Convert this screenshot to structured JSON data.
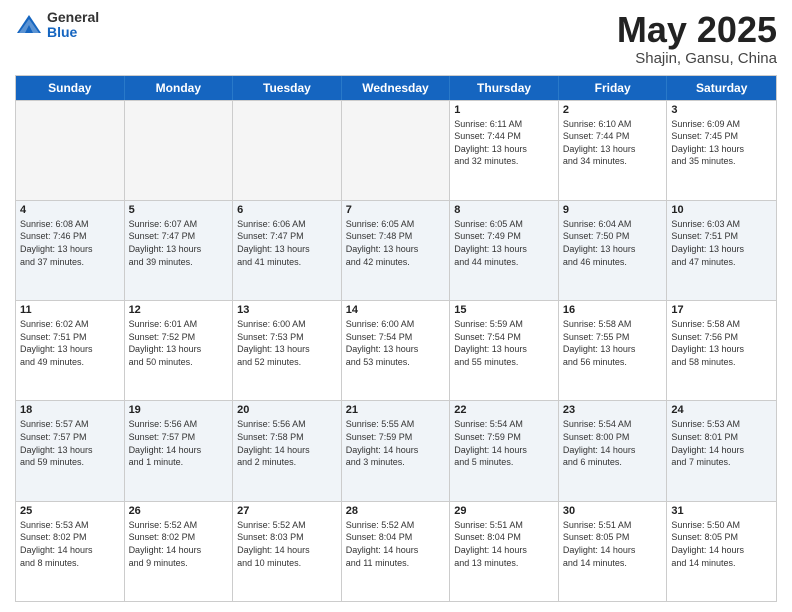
{
  "header": {
    "logo_general": "General",
    "logo_blue": "Blue",
    "title": "May 2025",
    "location": "Shajin, Gansu, China"
  },
  "days_of_week": [
    "Sunday",
    "Monday",
    "Tuesday",
    "Wednesday",
    "Thursday",
    "Friday",
    "Saturday"
  ],
  "weeks": [
    [
      {
        "day": "",
        "info": ""
      },
      {
        "day": "",
        "info": ""
      },
      {
        "day": "",
        "info": ""
      },
      {
        "day": "",
        "info": ""
      },
      {
        "day": "1",
        "info": "Sunrise: 6:11 AM\nSunset: 7:44 PM\nDaylight: 13 hours\nand 32 minutes."
      },
      {
        "day": "2",
        "info": "Sunrise: 6:10 AM\nSunset: 7:44 PM\nDaylight: 13 hours\nand 34 minutes."
      },
      {
        "day": "3",
        "info": "Sunrise: 6:09 AM\nSunset: 7:45 PM\nDaylight: 13 hours\nand 35 minutes."
      }
    ],
    [
      {
        "day": "4",
        "info": "Sunrise: 6:08 AM\nSunset: 7:46 PM\nDaylight: 13 hours\nand 37 minutes."
      },
      {
        "day": "5",
        "info": "Sunrise: 6:07 AM\nSunset: 7:47 PM\nDaylight: 13 hours\nand 39 minutes."
      },
      {
        "day": "6",
        "info": "Sunrise: 6:06 AM\nSunset: 7:47 PM\nDaylight: 13 hours\nand 41 minutes."
      },
      {
        "day": "7",
        "info": "Sunrise: 6:05 AM\nSunset: 7:48 PM\nDaylight: 13 hours\nand 42 minutes."
      },
      {
        "day": "8",
        "info": "Sunrise: 6:05 AM\nSunset: 7:49 PM\nDaylight: 13 hours\nand 44 minutes."
      },
      {
        "day": "9",
        "info": "Sunrise: 6:04 AM\nSunset: 7:50 PM\nDaylight: 13 hours\nand 46 minutes."
      },
      {
        "day": "10",
        "info": "Sunrise: 6:03 AM\nSunset: 7:51 PM\nDaylight: 13 hours\nand 47 minutes."
      }
    ],
    [
      {
        "day": "11",
        "info": "Sunrise: 6:02 AM\nSunset: 7:51 PM\nDaylight: 13 hours\nand 49 minutes."
      },
      {
        "day": "12",
        "info": "Sunrise: 6:01 AM\nSunset: 7:52 PM\nDaylight: 13 hours\nand 50 minutes."
      },
      {
        "day": "13",
        "info": "Sunrise: 6:00 AM\nSunset: 7:53 PM\nDaylight: 13 hours\nand 52 minutes."
      },
      {
        "day": "14",
        "info": "Sunrise: 6:00 AM\nSunset: 7:54 PM\nDaylight: 13 hours\nand 53 minutes."
      },
      {
        "day": "15",
        "info": "Sunrise: 5:59 AM\nSunset: 7:54 PM\nDaylight: 13 hours\nand 55 minutes."
      },
      {
        "day": "16",
        "info": "Sunrise: 5:58 AM\nSunset: 7:55 PM\nDaylight: 13 hours\nand 56 minutes."
      },
      {
        "day": "17",
        "info": "Sunrise: 5:58 AM\nSunset: 7:56 PM\nDaylight: 13 hours\nand 58 minutes."
      }
    ],
    [
      {
        "day": "18",
        "info": "Sunrise: 5:57 AM\nSunset: 7:57 PM\nDaylight: 13 hours\nand 59 minutes."
      },
      {
        "day": "19",
        "info": "Sunrise: 5:56 AM\nSunset: 7:57 PM\nDaylight: 14 hours\nand 1 minute."
      },
      {
        "day": "20",
        "info": "Sunrise: 5:56 AM\nSunset: 7:58 PM\nDaylight: 14 hours\nand 2 minutes."
      },
      {
        "day": "21",
        "info": "Sunrise: 5:55 AM\nSunset: 7:59 PM\nDaylight: 14 hours\nand 3 minutes."
      },
      {
        "day": "22",
        "info": "Sunrise: 5:54 AM\nSunset: 7:59 PM\nDaylight: 14 hours\nand 5 minutes."
      },
      {
        "day": "23",
        "info": "Sunrise: 5:54 AM\nSunset: 8:00 PM\nDaylight: 14 hours\nand 6 minutes."
      },
      {
        "day": "24",
        "info": "Sunrise: 5:53 AM\nSunset: 8:01 PM\nDaylight: 14 hours\nand 7 minutes."
      }
    ],
    [
      {
        "day": "25",
        "info": "Sunrise: 5:53 AM\nSunset: 8:02 PM\nDaylight: 14 hours\nand 8 minutes."
      },
      {
        "day": "26",
        "info": "Sunrise: 5:52 AM\nSunset: 8:02 PM\nDaylight: 14 hours\nand 9 minutes."
      },
      {
        "day": "27",
        "info": "Sunrise: 5:52 AM\nSunset: 8:03 PM\nDaylight: 14 hours\nand 10 minutes."
      },
      {
        "day": "28",
        "info": "Sunrise: 5:52 AM\nSunset: 8:04 PM\nDaylight: 14 hours\nand 11 minutes."
      },
      {
        "day": "29",
        "info": "Sunrise: 5:51 AM\nSunset: 8:04 PM\nDaylight: 14 hours\nand 13 minutes."
      },
      {
        "day": "30",
        "info": "Sunrise: 5:51 AM\nSunset: 8:05 PM\nDaylight: 14 hours\nand 14 minutes."
      },
      {
        "day": "31",
        "info": "Sunrise: 5:50 AM\nSunset: 8:05 PM\nDaylight: 14 hours\nand 14 minutes."
      }
    ]
  ]
}
